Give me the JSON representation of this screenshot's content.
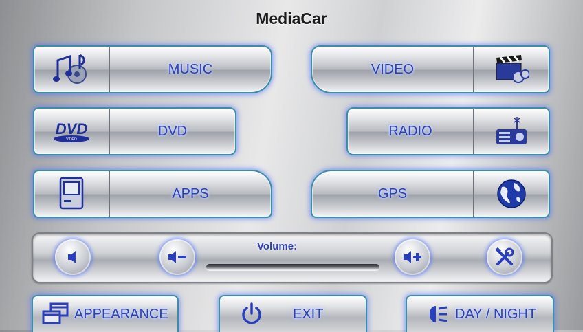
{
  "app": {
    "title": "MediaCar"
  },
  "menu": {
    "music": "MUSIC",
    "video": "VIDEO",
    "dvd": "DVD",
    "radio": "RADIO",
    "apps": "APPS",
    "gps": "GPS",
    "dvd_logo": "DVD",
    "dvd_logo_sub": "VIDEO"
  },
  "volume": {
    "label": "Volume:",
    "level": 0.0
  },
  "bottom": {
    "appearance": "APPEARANCE",
    "exit": "EXIT",
    "day_night": "DAY / NIGHT"
  },
  "colors": {
    "label_blue": "#2a3fbd",
    "glow": "#4666ff",
    "border_teal": "#3a8fa8"
  },
  "icons": [
    "music-notes-icon",
    "video-clapper-icon",
    "dvd-logo-icon",
    "radio-icon",
    "computer-icon",
    "globe-icon",
    "mute-icon",
    "volume-down-icon",
    "volume-up-icon",
    "settings-tools-icon",
    "windows-icon",
    "power-icon",
    "headlight-icon"
  ]
}
